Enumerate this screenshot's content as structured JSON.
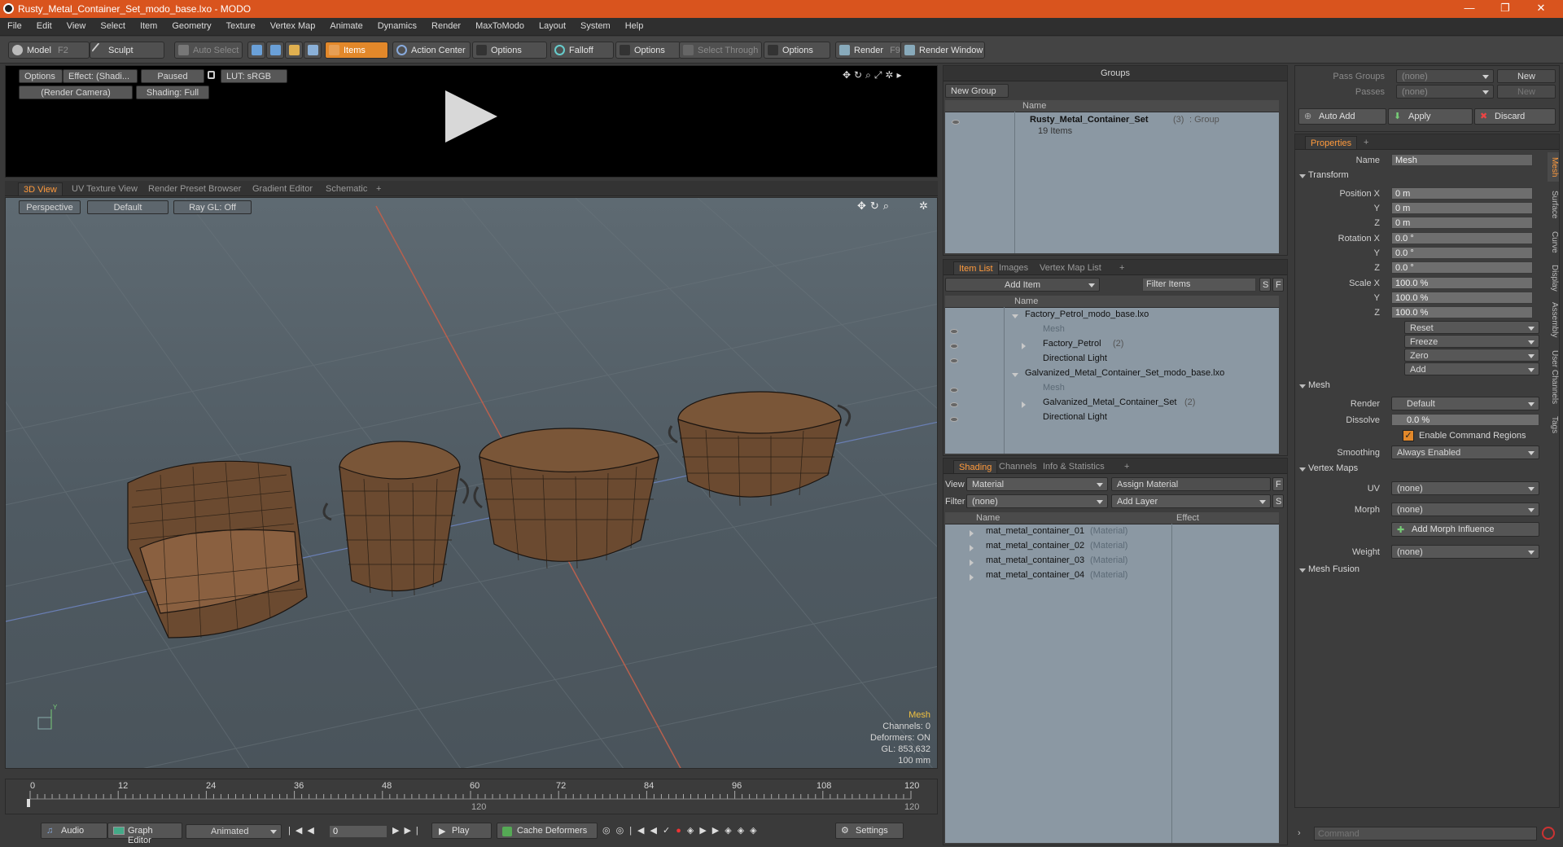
{
  "window": {
    "title": "Rusty_Metal_Container_Set_modo_base.lxo - MODO",
    "controls": [
      "—",
      "❐",
      "✕"
    ]
  },
  "menu": [
    "File",
    "Edit",
    "View",
    "Select",
    "Item",
    "Geometry",
    "Texture",
    "Vertex Map",
    "Animate",
    "Dynamics",
    "Render",
    "MaxToModo",
    "Layout",
    "System",
    "Help"
  ],
  "toolbar": {
    "model": "Model",
    "model_key": "F2",
    "sculpt": "Sculpt",
    "auto_select": "Auto Select",
    "items": "Items",
    "action_center": "Action Center",
    "options1": "Options",
    "falloff": "Falloff",
    "options2": "Options",
    "select_through": "Select Through",
    "options3": "Options",
    "render": "Render",
    "render_key": "F9",
    "render_window": "Render Window"
  },
  "preview": {
    "options": "Options",
    "effect": "Effect: (Shadi...",
    "paused": "Paused",
    "lut": "LUT: sRGB",
    "camera": "(Render Camera)",
    "shading": "Shading: Full"
  },
  "viewport": {
    "tabs": [
      "3D View",
      "UV Texture View",
      "Render Preset Browser",
      "Gradient Editor",
      "Schematic"
    ],
    "perspective": "Perspective",
    "default": "Default",
    "raygl": "Ray GL: Off",
    "info": {
      "mesh": "Mesh",
      "channels": "Channels: 0",
      "deformers": "Deformers: ON",
      "gl": "GL: 853,632",
      "scale": "100 mm"
    }
  },
  "timeline": {
    "ticks": [
      "0",
      "12",
      "24",
      "36",
      "48",
      "60",
      "72",
      "84",
      "96",
      "108",
      "120"
    ],
    "mid_label": "120",
    "end_label": "120"
  },
  "bottombar": {
    "audio": "Audio",
    "graph_editor": "Graph Editor",
    "animated": "Animated",
    "frame": "0",
    "play": "Play",
    "cache": "Cache Deformers",
    "settings": "Settings"
  },
  "groups": {
    "title": "Groups",
    "new_group": "New Group",
    "col_name": "Name",
    "item_name": "Rusty_Metal_Container_Set",
    "item_count": "(3)",
    "item_type": ": Group",
    "item_sub": "19 Items"
  },
  "itemlist": {
    "tabs": [
      "Item List",
      "Images",
      "Vertex Map List"
    ],
    "add_item": "Add Item",
    "filter": "Filter Items",
    "s": "S",
    "f": "F",
    "col_name": "Name",
    "rows": [
      {
        "name": "Factory_Petrol_modo_base.lxo",
        "suffix": "",
        "dim": false
      },
      {
        "name": "Mesh",
        "suffix": "",
        "dim": true
      },
      {
        "name": "Factory_Petrol",
        "suffix": "(2)",
        "dim": false
      },
      {
        "name": "Directional Light",
        "suffix": "",
        "dim": false
      },
      {
        "name": "Galvanized_Metal_Container_Set_modo_base.lxo",
        "suffix": "",
        "dim": false
      },
      {
        "name": "Mesh",
        "suffix": "",
        "dim": true
      },
      {
        "name": "Galvanized_Metal_Container_Set",
        "suffix": "(2)",
        "dim": false
      },
      {
        "name": "Directional Light",
        "suffix": "",
        "dim": false
      }
    ]
  },
  "shading": {
    "tabs": [
      "Shading",
      "Channels",
      "Info & Statistics"
    ],
    "view_label": "View",
    "view_value": "Material",
    "assign": "Assign Material",
    "f": "F",
    "filter_label": "Filter",
    "filter_value": "(none)",
    "add_layer": "Add Layer",
    "s": "S",
    "col_name": "Name",
    "col_effect": "Effect",
    "rows": [
      "mat_metal_container_01",
      "mat_metal_container_02",
      "mat_metal_container_03",
      "mat_metal_container_04"
    ],
    "row_type": "(Material)"
  },
  "passes": {
    "pass_groups": "Pass Groups",
    "passes": "Passes",
    "none": "(none)",
    "new": "New",
    "auto_add": "Auto Add",
    "apply": "Apply",
    "discard": "Discard"
  },
  "properties": {
    "tab": "Properties",
    "name_label": "Name",
    "name_value": "Mesh",
    "transform": "Transform",
    "position_label": "Position X",
    "rotation_label": "Rotation X",
    "scale_label": "Scale X",
    "y": "Y",
    "z": "Z",
    "pos": [
      "0 m",
      "0 m",
      "0 m"
    ],
    "rot": [
      "0.0 °",
      "0.0 °",
      "0.0 °"
    ],
    "scl": [
      "100.0 %",
      "100.0 %",
      "100.0 %"
    ],
    "reset": "Reset",
    "freeze": "Freeze",
    "zero": "Zero",
    "add": "Add",
    "mesh": "Mesh",
    "render_label": "Render",
    "render_value": "Default",
    "dissolve_label": "Dissolve",
    "dissolve_value": "0.0 %",
    "enable_cmd": "Enable Command Regions",
    "smoothing_label": "Smoothing",
    "smoothing_value": "Always Enabled",
    "vertex_maps": "Vertex Maps",
    "uv_label": "UV",
    "uv_value": "(none)",
    "morph_label": "Morph",
    "morph_value": "(none)",
    "add_morph": "Add Morph Influence",
    "weight_label": "Weight",
    "weight_value": "(none)",
    "mesh_fusion": "Mesh Fusion",
    "side_tabs": [
      "Mesh",
      "Surface",
      "Curve",
      "Display",
      "Assembly",
      "User Channels",
      "Tags"
    ]
  },
  "command": {
    "placeholder": "Command"
  },
  "colors": {
    "accent": "#e2882a",
    "title": "#d9541e",
    "highlight": "#ff9a3c"
  }
}
